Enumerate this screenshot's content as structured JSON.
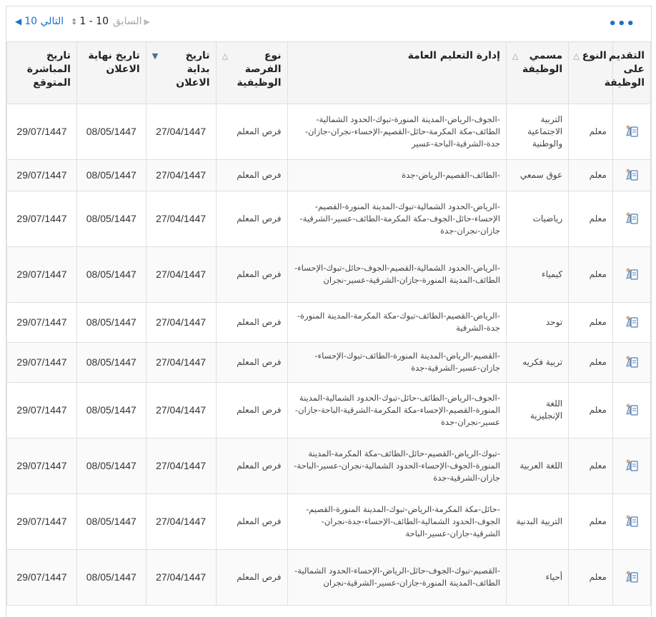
{
  "toolbar": {
    "next_label": "التالي 10",
    "range_label": "1 - 10",
    "prev_label": "السابق",
    "more_label": "•••"
  },
  "columns": {
    "apply": "التقديم على الوظيفة",
    "type": "النوع",
    "title": "مسمي الوظيفة",
    "admin": "إدارة التعليم العامة",
    "opp": "نوع الفرصة الوظيفية",
    "start": "تاريخ بداية الاعلان",
    "end": "تاريخ نهاية الاعلان",
    "direct": "تاريخ المباشرة المتوقع"
  },
  "rows": [
    {
      "type": "معلم",
      "title": "التربية الاجتماعية والوطنية",
      "admin": "-الجوف-الرياض-المدينة المنورة-تبوك-الحدود الشمالية-الطائف-مكة المكرمة-حائل-القصيم-الإحساء-نجران-جازان-جدة-الشرقية-الباحة-عسير",
      "opp": "فرص المعلم",
      "start": "27/04/1447",
      "end": "08/05/1447",
      "direct": "29/07/1447"
    },
    {
      "type": "معلم",
      "title": "عوق سمعي",
      "admin": "-الطائف-القصيم-الرياض-جدة",
      "opp": "فرص المعلم",
      "start": "27/04/1447",
      "end": "08/05/1447",
      "direct": "29/07/1447"
    },
    {
      "type": "معلم",
      "title": "رياضيات",
      "admin": "-الرياض-الحدود الشمالية-تبوك-المدينة المنورة-القصيم-الإحساء-حائل-الجوف-مكة المكرمة-الطائف-عسير-الشرقية-جازان-نجران-جدة",
      "opp": "فرص المعلم",
      "start": "27/04/1447",
      "end": "08/05/1447",
      "direct": "29/07/1447"
    },
    {
      "type": "معلم",
      "title": "كيمياء",
      "admin": "-الرياض-الحدود الشمالية-القصيم-الجوف-حائل-تبوك-الإحساء-الطائف-المدينة المنورة-جازان-الشرقية-عسير-نجران",
      "opp": "فرص المعلم",
      "start": "27/04/1447",
      "end": "08/05/1447",
      "direct": "29/07/1447"
    },
    {
      "type": "معلم",
      "title": "توحد",
      "admin": "-الرياض-القصيم-الطائف-تبوك-مكة المكرمة-المدينة المنورة-جدة-الشرقية",
      "opp": "فرص المعلم",
      "start": "27/04/1447",
      "end": "08/05/1447",
      "direct": "29/07/1447"
    },
    {
      "type": "معلم",
      "title": "تربية فكريه",
      "admin": "-القصيم-الرياض-المدينة المنورة-الطائف-تبوك-الإحساء-جازان-عسير-الشرقية-جدة",
      "opp": "فرص المعلم",
      "start": "27/04/1447",
      "end": "08/05/1447",
      "direct": "29/07/1447"
    },
    {
      "type": "معلم",
      "title": "اللغة الإنجليزية",
      "admin": "-الجوف-الرياض-الطائف-حائل-تبوك-الحدود الشمالية-المدينة المنورة-القصيم-الإحساء-مكة المكرمة-الشرقية-الباحة-جازان-عسير-نجران-جدة",
      "opp": "فرص المعلم",
      "start": "27/04/1447",
      "end": "08/05/1447",
      "direct": "29/07/1447"
    },
    {
      "type": "معلم",
      "title": "اللغة العربية",
      "admin": "-تبوك-الرياض-القصيم-حائل-الطائف-مكة المكرمة-المدينة المنورة-الجوف-الإحساء-الحدود الشمالية-نجران-عسير-الباحة-جازان-الشرقية-جدة",
      "opp": "فرص المعلم",
      "start": "27/04/1447",
      "end": "08/05/1447",
      "direct": "29/07/1447"
    },
    {
      "type": "معلم",
      "title": "التربية البدنية",
      "admin": "-حائل-مكة المكرمة-الرياض-تبوك-المدينة المنورة-القصيم-الجوف-الحدود الشمالية-الطائف-الإحساء-جدة-نجران-الشرقية-جازان-عسير-الباحة",
      "opp": "فرص المعلم",
      "start": "27/04/1447",
      "end": "08/05/1447",
      "direct": "29/07/1447"
    },
    {
      "type": "معلم",
      "title": "أحياء",
      "admin": "-القصيم-تبوك-الجوف-حائل-الرياض-الإحساء-الحدود الشمالية-الطائف-المدينة المنورة-جازان-عسير-الشرقية-نجران",
      "opp": "فرص المعلم",
      "start": "27/04/1447",
      "end": "08/05/1447",
      "direct": "29/07/1447"
    }
  ]
}
